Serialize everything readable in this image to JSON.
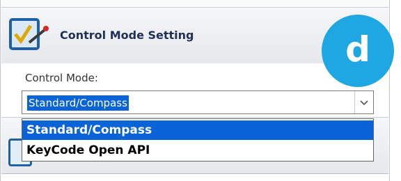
{
  "panel": {
    "title": "Control Mode Setting"
  },
  "form": {
    "label": "Control Mode:",
    "selected_value": "Standard/Compass",
    "options": [
      "Standard/Compass",
      "KeyCode Open API"
    ]
  },
  "badge": {
    "letter": "d",
    "color": "#1ea7e2"
  },
  "colors": {
    "selection": "#0a64d8",
    "title": "#1f2f55"
  },
  "icons": {
    "app": "settings-checklist-icon",
    "dropdown": "chevron-down-icon"
  }
}
